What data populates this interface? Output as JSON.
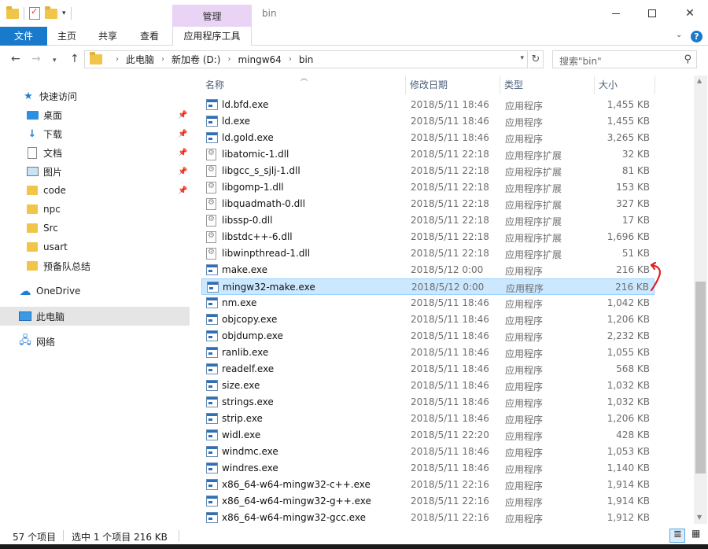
{
  "titlebar": {
    "context_tab": "管理",
    "window_title": "bin",
    "qat_dropdown": "▾"
  },
  "ribbon": {
    "tabs": [
      "文件",
      "主页",
      "共享",
      "查看",
      "应用程序工具"
    ],
    "help": "?"
  },
  "address": {
    "crumbs": [
      "此电脑",
      "新加卷 (D:)",
      "mingw64",
      "bin"
    ],
    "search_placeholder": "搜索\"bin\""
  },
  "sidebar": {
    "quick_access": "快速访问",
    "items": [
      {
        "label": "桌面",
        "icon": "desktop-icon",
        "pinned": true
      },
      {
        "label": "下载",
        "icon": "download-icon",
        "pinned": true
      },
      {
        "label": "文档",
        "icon": "document-icon",
        "pinned": true
      },
      {
        "label": "图片",
        "icon": "pictures-icon",
        "pinned": true
      },
      {
        "label": "code",
        "icon": "folder-icon",
        "pinned": true
      },
      {
        "label": "npc",
        "icon": "folder-icon",
        "pinned": false
      },
      {
        "label": "Src",
        "icon": "folder-icon",
        "pinned": false
      },
      {
        "label": "usart",
        "icon": "folder-icon",
        "pinned": false
      },
      {
        "label": "预备队总结",
        "icon": "folder-icon",
        "pinned": false
      }
    ],
    "onedrive": "OneDrive",
    "this_pc": "此电脑",
    "network": "网络"
  },
  "columns": {
    "name": "名称",
    "date": "修改日期",
    "type": "类型",
    "size": "大小"
  },
  "files": [
    {
      "name": "ld.bfd.exe",
      "date": "2018/5/11 18:46",
      "type": "应用程序",
      "size": "1,455 KB",
      "kind": "exe"
    },
    {
      "name": "ld.exe",
      "date": "2018/5/11 18:46",
      "type": "应用程序",
      "size": "1,455 KB",
      "kind": "exe"
    },
    {
      "name": "ld.gold.exe",
      "date": "2018/5/11 18:46",
      "type": "应用程序",
      "size": "3,265 KB",
      "kind": "exe"
    },
    {
      "name": "libatomic-1.dll",
      "date": "2018/5/11 22:18",
      "type": "应用程序扩展",
      "size": "32 KB",
      "kind": "dll"
    },
    {
      "name": "libgcc_s_sjlj-1.dll",
      "date": "2018/5/11 22:18",
      "type": "应用程序扩展",
      "size": "81 KB",
      "kind": "dll"
    },
    {
      "name": "libgomp-1.dll",
      "date": "2018/5/11 22:18",
      "type": "应用程序扩展",
      "size": "153 KB",
      "kind": "dll"
    },
    {
      "name": "libquadmath-0.dll",
      "date": "2018/5/11 22:18",
      "type": "应用程序扩展",
      "size": "327 KB",
      "kind": "dll"
    },
    {
      "name": "libssp-0.dll",
      "date": "2018/5/11 22:18",
      "type": "应用程序扩展",
      "size": "17 KB",
      "kind": "dll"
    },
    {
      "name": "libstdc++-6.dll",
      "date": "2018/5/11 22:18",
      "type": "应用程序扩展",
      "size": "1,696 KB",
      "kind": "dll"
    },
    {
      "name": "libwinpthread-1.dll",
      "date": "2018/5/11 22:18",
      "type": "应用程序扩展",
      "size": "51 KB",
      "kind": "dll"
    },
    {
      "name": "make.exe",
      "date": "2018/5/12 0:00",
      "type": "应用程序",
      "size": "216 KB",
      "kind": "exe"
    },
    {
      "name": "mingw32-make.exe",
      "date": "2018/5/12 0:00",
      "type": "应用程序",
      "size": "216 KB",
      "kind": "exe",
      "selected": true
    },
    {
      "name": "nm.exe",
      "date": "2018/5/11 18:46",
      "type": "应用程序",
      "size": "1,042 KB",
      "kind": "exe"
    },
    {
      "name": "objcopy.exe",
      "date": "2018/5/11 18:46",
      "type": "应用程序",
      "size": "1,206 KB",
      "kind": "exe"
    },
    {
      "name": "objdump.exe",
      "date": "2018/5/11 18:46",
      "type": "应用程序",
      "size": "2,232 KB",
      "kind": "exe"
    },
    {
      "name": "ranlib.exe",
      "date": "2018/5/11 18:46",
      "type": "应用程序",
      "size": "1,055 KB",
      "kind": "exe"
    },
    {
      "name": "readelf.exe",
      "date": "2018/5/11 18:46",
      "type": "应用程序",
      "size": "568 KB",
      "kind": "exe"
    },
    {
      "name": "size.exe",
      "date": "2018/5/11 18:46",
      "type": "应用程序",
      "size": "1,032 KB",
      "kind": "exe"
    },
    {
      "name": "strings.exe",
      "date": "2018/5/11 18:46",
      "type": "应用程序",
      "size": "1,032 KB",
      "kind": "exe"
    },
    {
      "name": "strip.exe",
      "date": "2018/5/11 18:46",
      "type": "应用程序",
      "size": "1,206 KB",
      "kind": "exe"
    },
    {
      "name": "widl.exe",
      "date": "2018/5/11 22:20",
      "type": "应用程序",
      "size": "428 KB",
      "kind": "exe"
    },
    {
      "name": "windmc.exe",
      "date": "2018/5/11 18:46",
      "type": "应用程序",
      "size": "1,053 KB",
      "kind": "exe"
    },
    {
      "name": "windres.exe",
      "date": "2018/5/11 18:46",
      "type": "应用程序",
      "size": "1,140 KB",
      "kind": "exe"
    },
    {
      "name": "x86_64-w64-mingw32-c++.exe",
      "date": "2018/5/11 22:16",
      "type": "应用程序",
      "size": "1,914 KB",
      "kind": "exe"
    },
    {
      "name": "x86_64-w64-mingw32-g++.exe",
      "date": "2018/5/11 22:16",
      "type": "应用程序",
      "size": "1,914 KB",
      "kind": "exe"
    },
    {
      "name": "x86_64-w64-mingw32-gcc.exe",
      "date": "2018/5/11 22:16",
      "type": "应用程序",
      "size": "1,912 KB",
      "kind": "exe"
    }
  ],
  "status": {
    "count": "57 个项目",
    "selection": "选中 1 个项目  216 KB"
  },
  "colors": {
    "accent": "#1979ca",
    "context_tab": "#e9d4f6",
    "selection_bg": "#cce8ff",
    "annotation": "#e02020"
  }
}
